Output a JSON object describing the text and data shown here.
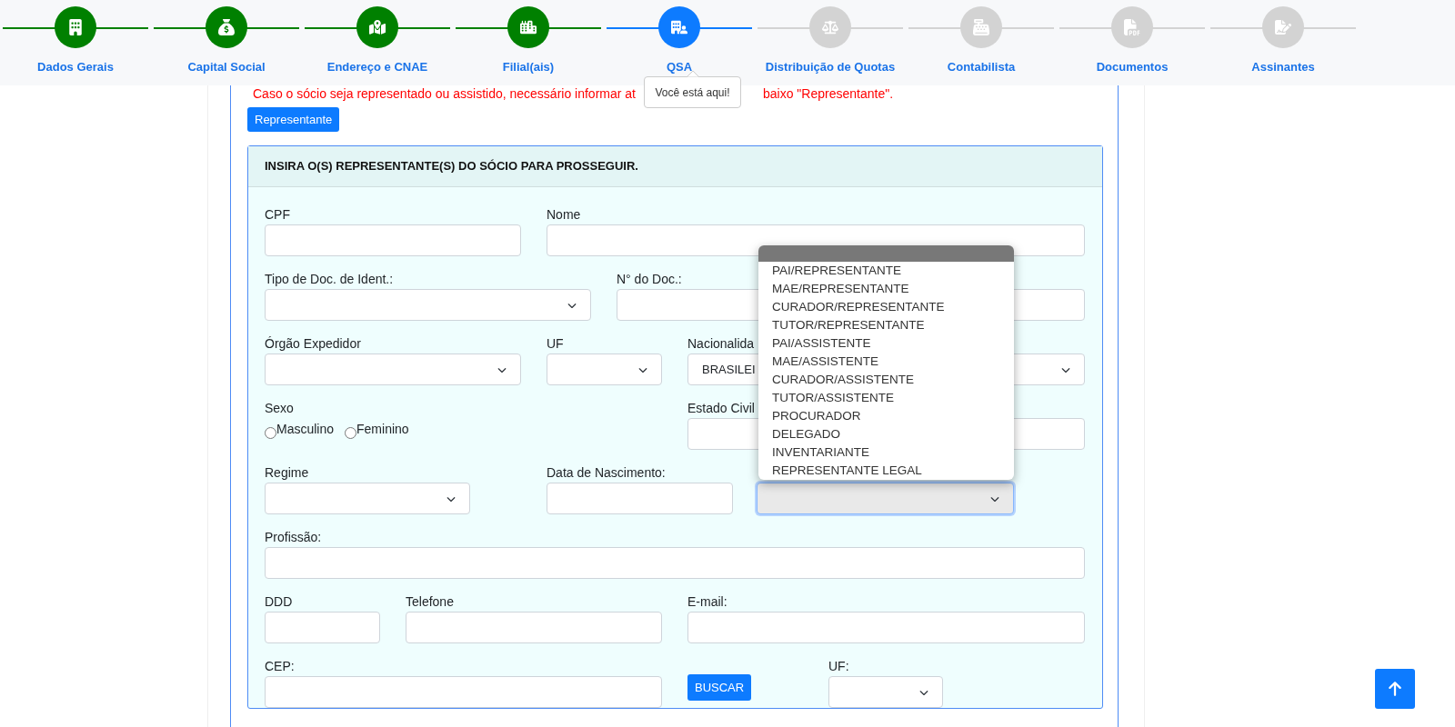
{
  "steps": [
    {
      "label": "Dados Gerais",
      "completed": true,
      "current": false
    },
    {
      "label": "Capital Social",
      "completed": true,
      "current": false
    },
    {
      "label": "Endereço e CNAE",
      "completed": true,
      "current": false
    },
    {
      "label": "Filial(ais)",
      "completed": true,
      "current": false
    },
    {
      "label": "QSA",
      "completed": false,
      "current": true
    },
    {
      "label": "Distribuição de Quotas",
      "completed": false,
      "current": false
    },
    {
      "label": "Contabilista",
      "completed": false,
      "current": false
    },
    {
      "label": "Documentos",
      "completed": false,
      "current": false
    },
    {
      "label": "Assinantes",
      "completed": false,
      "current": false
    }
  ],
  "tooltip": "Você está aqui!",
  "notice_start": "Caso o sócio seja representado ou assistido, necessário informar at",
  "notice_end": "baixo \"Representante\".",
  "representante_button": "Representante",
  "panel": {
    "title": "INSIRA O(S) REPRESENTANTE(S) DO SÓCIO PARA PROSSEGUIR.",
    "rows": [
      [
        {
          "kind": "input",
          "label": "CPF"
        },
        {
          "kind": "input",
          "label": "Nome"
        }
      ],
      [
        {
          "kind": "select",
          "label": "Tipo de Doc. de Ident.:"
        },
        {
          "kind": "input",
          "label": "N° do Doc.:"
        }
      ],
      [
        {
          "kind": "select",
          "label": "Órgão Expedidor"
        },
        {
          "kind": "select",
          "label": "UF"
        },
        {
          "kind": "select",
          "label": "Nacionalida",
          "value": "BRASILEI"
        }
      ],
      [
        {
          "kind": "radio",
          "label": "Sexo",
          "options": [
            {
              "label": "Masculino",
              "checked": false
            },
            {
              "label": "Feminino",
              "checked": false
            }
          ]
        },
        {
          "kind": "input",
          "label": "Estado Civil"
        }
      ],
      [
        {
          "kind": "select",
          "label": "Regime"
        },
        {
          "kind": "input",
          "label": "Data de Nascimento:"
        },
        {
          "kind": "select",
          "focused": true,
          "open": true,
          "options": [
            "PAI/REPRESENTANTE",
            "MAE/REPRESENTANTE",
            "CURADOR/REPRESENTANTE",
            "TUTOR/REPRESENTANTE",
            "PAI/ASSISTENTE",
            "MAE/ASSISTENTE",
            "CURADOR/ASSISTENTE",
            "TUTOR/ASSISTENTE",
            "PROCURADOR",
            "DELEGADO",
            "INVENTARIANTE",
            "REPRESENTANTE LEGAL"
          ]
        }
      ],
      [
        {
          "kind": "input",
          "label": "Profissão:"
        }
      ],
      [
        {
          "kind": "input",
          "label": "DDD"
        },
        {
          "kind": "input",
          "label": "Telefone"
        },
        {
          "kind": "input",
          "label": "E-mail:"
        }
      ],
      [
        {
          "kind": "input",
          "label": "CEP:"
        },
        {
          "kind": "button",
          "label": "BUSCAR"
        },
        {
          "kind": "select",
          "label": "UF:"
        }
      ]
    ]
  }
}
